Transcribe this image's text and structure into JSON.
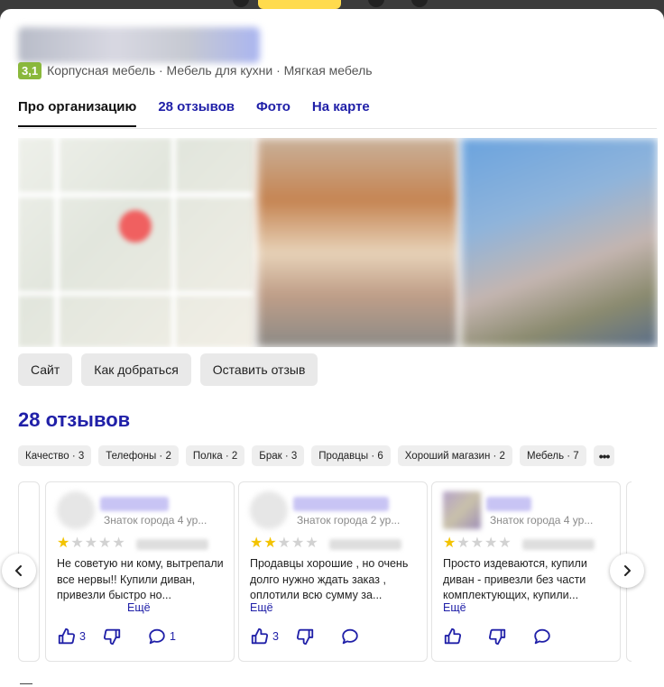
{
  "header": {
    "rating": "3,1",
    "categories": "Корпусная мебель · Мебель для кухни · Мягкая мебель"
  },
  "tabs": [
    {
      "label": "Про организацию",
      "active": true
    },
    {
      "label": "28 отзывов",
      "active": false
    },
    {
      "label": "Фото",
      "active": false
    },
    {
      "label": "На карте",
      "active": false
    }
  ],
  "actions": {
    "site": "Сайт",
    "route": "Как добраться",
    "review": "Оставить отзыв"
  },
  "reviews": {
    "title": "28 отзывов",
    "chips": [
      {
        "label": "Качество · 3"
      },
      {
        "label": "Телефоны · 2"
      },
      {
        "label": "Полка · 2"
      },
      {
        "label": "Брак · 3"
      },
      {
        "label": "Продавцы · 6"
      },
      {
        "label": "Хороший магазин · 2"
      },
      {
        "label": "Мебель · 7"
      }
    ],
    "more_chip": "•••",
    "items": [
      {
        "user_level": "Знаток города 4 ур...",
        "stars": 1,
        "text": "Не советую ни кому, вытрепали все нервы!! Купили диван, привезли быстро но...",
        "more": "Ещё",
        "likes": "3",
        "comments": "1"
      },
      {
        "user_level": "Знаток города 2 ур...",
        "stars": 2,
        "text": "Продавцы хорошие , но очень долго нужно ждать заказ , оплотили всю сумму за...",
        "more": "Ещё",
        "likes": "3",
        "comments": ""
      },
      {
        "user_level": "Знаток города 4 ур...",
        "stars": 1,
        "text": "Просто издеваются, купили диван - привезли без части комплектующих, купили...",
        "more": "Ещё",
        "likes": "",
        "comments": ""
      }
    ]
  },
  "colors": {
    "accent": "#2020a8",
    "rating_badge": "#8ab83c",
    "star": "#f3c300"
  },
  "icons": {
    "like": "thumbs-up-icon",
    "dislike": "thumbs-down-icon",
    "comment": "comment-icon",
    "prev": "chevron-left-icon",
    "next": "chevron-right-icon"
  }
}
